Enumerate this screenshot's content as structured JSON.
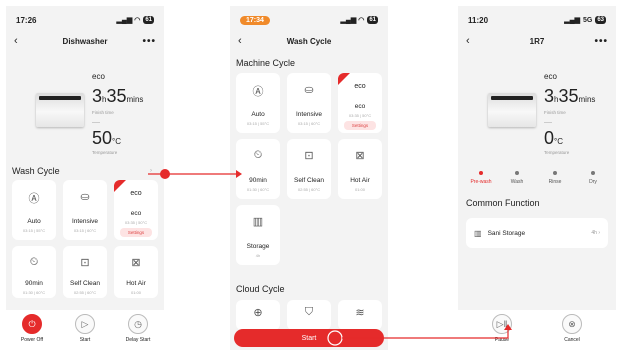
{
  "colors": {
    "accent": "#e52b2b",
    "background": "#f3f3f3",
    "card": "#ffffff"
  },
  "screen1": {
    "time": "17:26",
    "title": "Dishwasher",
    "mode": "eco",
    "finish_value": "3",
    "finish_h": "h",
    "finish_mins": "35",
    "finish_unit": "mins",
    "finish_label": "Finish time",
    "temp_value": "50",
    "temp_unit": "°C",
    "temp_label": "Temperature",
    "section": "Wash Cycle",
    "cycles": [
      {
        "name": "Auto",
        "sub": "03:15 | 55°C",
        "icon": "Ⓐ"
      },
      {
        "name": "Intensive",
        "sub": "03:15 | 60°C",
        "icon": "⛀"
      },
      {
        "name": "eco",
        "label": "eco",
        "sub": "03:35 | 50°C",
        "badge": "Settings",
        "icon": "eco"
      },
      {
        "name": "90min",
        "sub": "01:30 | 60°C",
        "icon": "⏲"
      },
      {
        "name": "Self Clean",
        "sub": "02:55 | 60°C",
        "icon": "⊡"
      },
      {
        "name": "Hot Air",
        "sub": "01:00",
        "icon": "⊠"
      }
    ],
    "bottom": [
      {
        "label": "Power Off",
        "icon": "⏻"
      },
      {
        "label": "Start",
        "icon": "▷"
      },
      {
        "label": "Delay Start",
        "icon": "◷"
      }
    ]
  },
  "screen2": {
    "time": "17:34",
    "title": "Wash Cycle",
    "section1": "Machine Cycle",
    "cycles": [
      {
        "name": "Auto",
        "sub": "03:15 | 55°C",
        "icon": "Ⓐ"
      },
      {
        "name": "Intensive",
        "sub": "03:15 | 60°C",
        "icon": "⛀"
      },
      {
        "name": "eco",
        "label": "eco",
        "sub": "03:35 | 50°C",
        "badge": "Settings",
        "icon": "eco"
      },
      {
        "name": "90min",
        "sub": "01:30 | 60°C",
        "icon": "⏲"
      },
      {
        "name": "Self Clean",
        "sub": "02:55 | 60°C",
        "icon": "⊡"
      },
      {
        "name": "Hot Air",
        "sub": "01:00",
        "icon": "⊠"
      },
      {
        "name": "Storage",
        "sub": "4h",
        "icon": "▥"
      }
    ],
    "section2": "Cloud Cycle",
    "start": "Start"
  },
  "screen3": {
    "time": "11:20",
    "network": "5G",
    "title": "1R7",
    "mode": "eco",
    "finish_value": "3",
    "finish_h": "h",
    "finish_mins": "35",
    "finish_unit": "mins",
    "finish_label": "Finish time",
    "temp_value": "0",
    "temp_unit": "°C",
    "temp_label": "Temperature",
    "steps": [
      "Pre-wash",
      "Wash",
      "Rinse",
      "Dry"
    ],
    "section": "Common Function",
    "function": {
      "name": "Sani Storage",
      "value": "4h",
      "icon": "▥"
    },
    "bottom": [
      {
        "label": "Pause",
        "icon": "▷‖"
      },
      {
        "label": "Cancel",
        "icon": "⊗"
      }
    ]
  }
}
